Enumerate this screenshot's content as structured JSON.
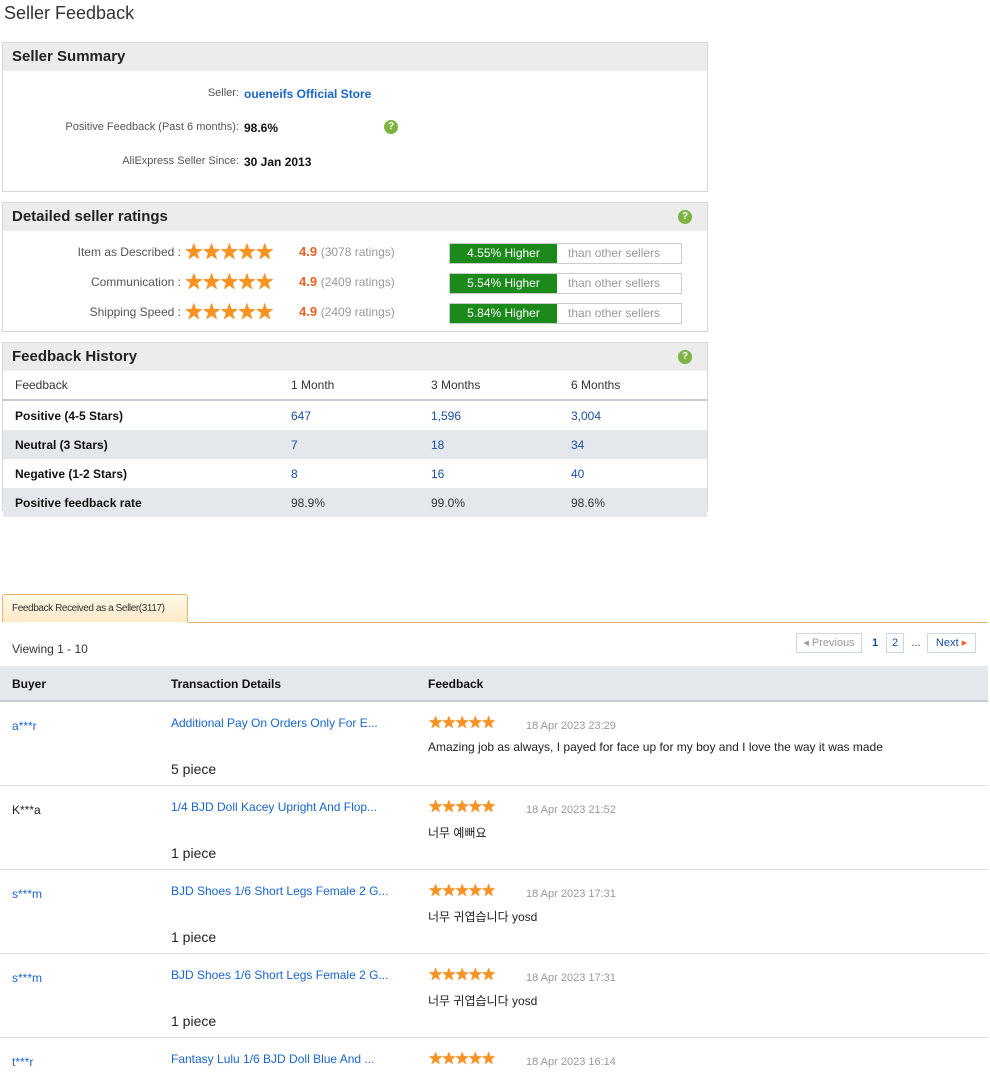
{
  "page_title": "Seller Feedback",
  "summary": {
    "title": "Seller Summary",
    "seller_label": "Seller:",
    "seller_name": "oueneifs Official Store",
    "positive_label": "Positive Feedback (Past 6 months):",
    "positive_value": "98.6%",
    "since_label": "AliExpress Seller Since:",
    "since_value": "30 Jan 2013"
  },
  "ratings": {
    "title": "Detailed seller ratings",
    "rows": [
      {
        "label": "Item as Described :",
        "stars": "★★★★★",
        "score": "4.9",
        "count": "(3078 ratings)",
        "compare": "4.55% Higher",
        "compare_text": "than other sellers"
      },
      {
        "label": "Communication :",
        "stars": "★★★★★",
        "score": "4.9",
        "count": "(2409 ratings)",
        "compare": "5.54% Higher",
        "compare_text": "than other sellers"
      },
      {
        "label": "Shipping Speed :",
        "stars": "★★★★★",
        "score": "4.9",
        "count": "(2409 ratings)",
        "compare": "5.84% Higher",
        "compare_text": "than other sellers"
      }
    ]
  },
  "history": {
    "title": "Feedback History",
    "columns": [
      "Feedback",
      "1 Month",
      "3 Months",
      "6 Months"
    ],
    "rows": [
      {
        "label": "Positive (4-5 Stars)",
        "values": [
          "647",
          "1,596",
          "3,004"
        ]
      },
      {
        "label": "Neutral (3 Stars)",
        "values": [
          "7",
          "18",
          "34"
        ]
      },
      {
        "label": "Negative (1-2 Stars)",
        "values": [
          "8",
          "16",
          "40"
        ]
      },
      {
        "label": "Positive feedback rate",
        "values": [
          "98.9%",
          "99.0%",
          "98.6%"
        ]
      }
    ]
  },
  "feedback": {
    "tab_label": "Feedback Received as a Seller(3117)",
    "viewing": "Viewing 1 - 10",
    "pager": {
      "prev": "◂ Previous",
      "pages": [
        "1",
        "2"
      ],
      "ellipsis": "...",
      "next": "Next"
    },
    "columns": [
      "Buyer",
      "Transaction Details",
      "Feedback"
    ],
    "rows": [
      {
        "buyer": "a***r",
        "product": "Additional Pay On Orders Only For E...",
        "qty": "5 piece",
        "stars": "★★★★★",
        "date": "18 Apr 2023 23:29",
        "text": "Amazing job as always, I payed for face up for my boy and I love the way it was made"
      },
      {
        "buyer": "K***a",
        "product": "1/4 BJD Doll Kacey Upright And Flop...",
        "qty": "1 piece",
        "stars": "★★★★★",
        "date": "18 Apr 2023 21:52",
        "text": "너무 예뻐요"
      },
      {
        "buyer": "s***m",
        "product": "BJD Shoes 1/6 Short Legs Female 2 G...",
        "qty": "1 piece",
        "stars": "★★★★★",
        "date": "18 Apr 2023 17:31",
        "text": "너무 귀엽습니다 yosd"
      },
      {
        "buyer": "s***m",
        "product": "BJD Shoes 1/6 Short Legs Female 2 G...",
        "qty": "1 piece",
        "stars": "★★★★★",
        "date": "18 Apr 2023 17:31",
        "text": "너무 귀엽습니다 yosd"
      },
      {
        "buyer": "t***r",
        "product": "Fantasy Lulu 1/6 BJD Doll Blue And ...",
        "qty": "",
        "stars": "★★★★★",
        "date": "18 Apr 2023 16:14",
        "text": ""
      }
    ]
  },
  "colors": {
    "accent_blue": "#1a66cc",
    "star_orange": "#f7931e",
    "higher_green": "#1b8a1b",
    "score_orange": "#e8631f"
  }
}
